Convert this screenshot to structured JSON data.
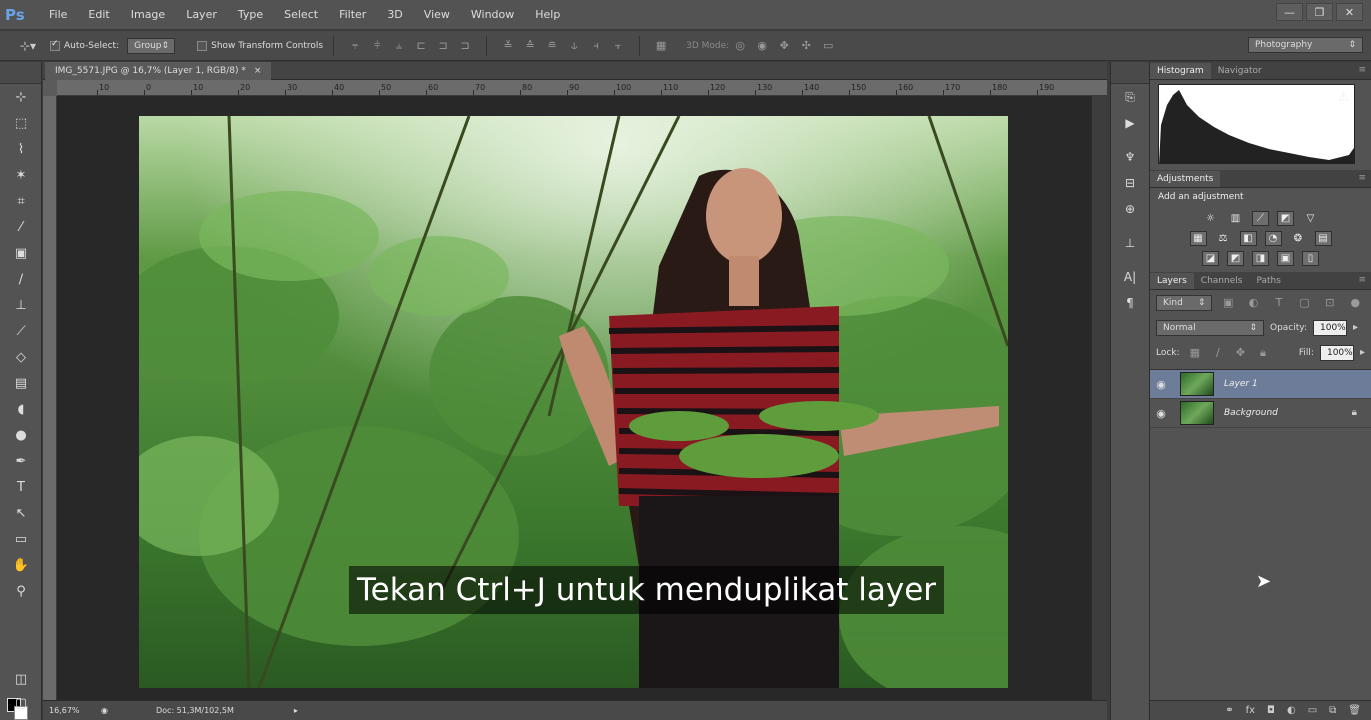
{
  "app": {
    "logo": "Ps"
  },
  "menu": [
    "File",
    "Edit",
    "Image",
    "Layer",
    "Type",
    "Select",
    "Filter",
    "3D",
    "View",
    "Window",
    "Help"
  ],
  "window_buttons": [
    "—",
    "❐",
    "✕"
  ],
  "options": {
    "auto_select_label": "Auto-Select:",
    "auto_select_value": "Group",
    "transform_label": "Show Transform Controls",
    "mode_label": "3D Mode:",
    "workspace": "Photography"
  },
  "document": {
    "tab_title": "IMG_5571.JPG @ 16,7% (Layer 1, RGB/8) *",
    "tab_close": "×",
    "ruler_ticks": [
      "10",
      "0",
      "10",
      "20",
      "30",
      "40",
      "50",
      "60",
      "70",
      "80",
      "90",
      "100",
      "110",
      "120",
      "130",
      "140",
      "150",
      "160",
      "170",
      "180",
      "190"
    ],
    "caption": "Tekan Ctrl+J untuk menduplikat layer",
    "zoom": "16,67%",
    "doc_info": "Doc: 51,3M/102,5M"
  },
  "panels": {
    "top_tabs": [
      "Histogram",
      "Navigator"
    ],
    "adjustments_tab": "Adjustments",
    "add_adjustment": "Add an adjustment",
    "layer_tabs": [
      "Layers",
      "Channels",
      "Paths"
    ],
    "kind": "Kind",
    "blend_mode": "Normal",
    "opacity_label": "Opacity:",
    "opacity_value": "100%",
    "lock_label": "Lock:",
    "fill_label": "Fill:",
    "fill_value": "100%",
    "layers": [
      {
        "name": "Layer 1",
        "active": true
      },
      {
        "name": "Background",
        "active": false
      }
    ]
  }
}
